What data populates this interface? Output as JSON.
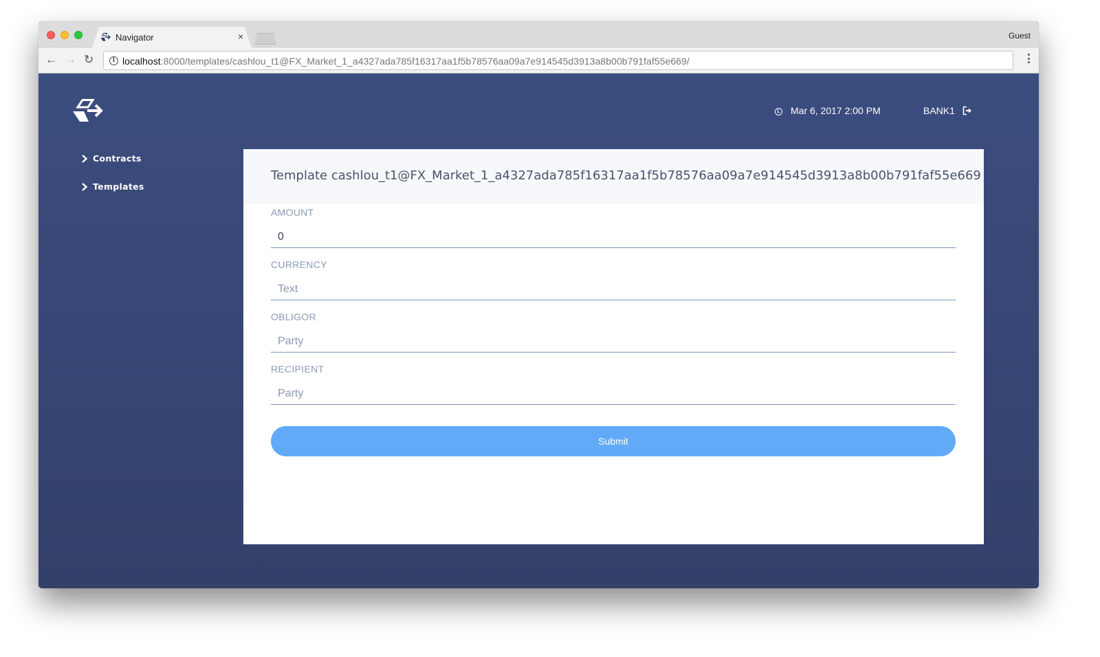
{
  "browser": {
    "tab_title": "Navigator",
    "tab_close": "×",
    "profile": "Guest",
    "url_host": "localhost",
    "url_rest": ":8000/templates/cashlou_t1@FX_Market_1_a4327ada785f16317aa1f5b78576aa09a7e914545d3913a8b00b791faf55e669/",
    "nav": {
      "back": "←",
      "forward": "→",
      "reload": "↻"
    },
    "info_glyph": "i"
  },
  "header": {
    "datetime": "Mar 6, 2017 2:00 PM",
    "user": "BANK1"
  },
  "sidebar": {
    "items": [
      {
        "label": "Contracts"
      },
      {
        "label": "Templates"
      }
    ]
  },
  "template": {
    "title": "Template cashlou_t1@FX_Market_1_a4327ada785f16317aa1f5b78576aa09a7e914545d3913a8b00b791faf55e669",
    "fields": [
      {
        "label": "AMOUNT",
        "value": "0",
        "placeholder": ""
      },
      {
        "label": "CURRENCY",
        "value": "",
        "placeholder": "Text"
      },
      {
        "label": "OBLIGOR",
        "value": "",
        "placeholder": "Party"
      },
      {
        "label": "RECIPIENT",
        "value": "",
        "placeholder": "Party"
      }
    ],
    "submit_label": "Submit"
  },
  "colors": {
    "app_background": "#3a4c7d",
    "submit_button": "#62a9f8",
    "label": "#8a9ab5"
  }
}
